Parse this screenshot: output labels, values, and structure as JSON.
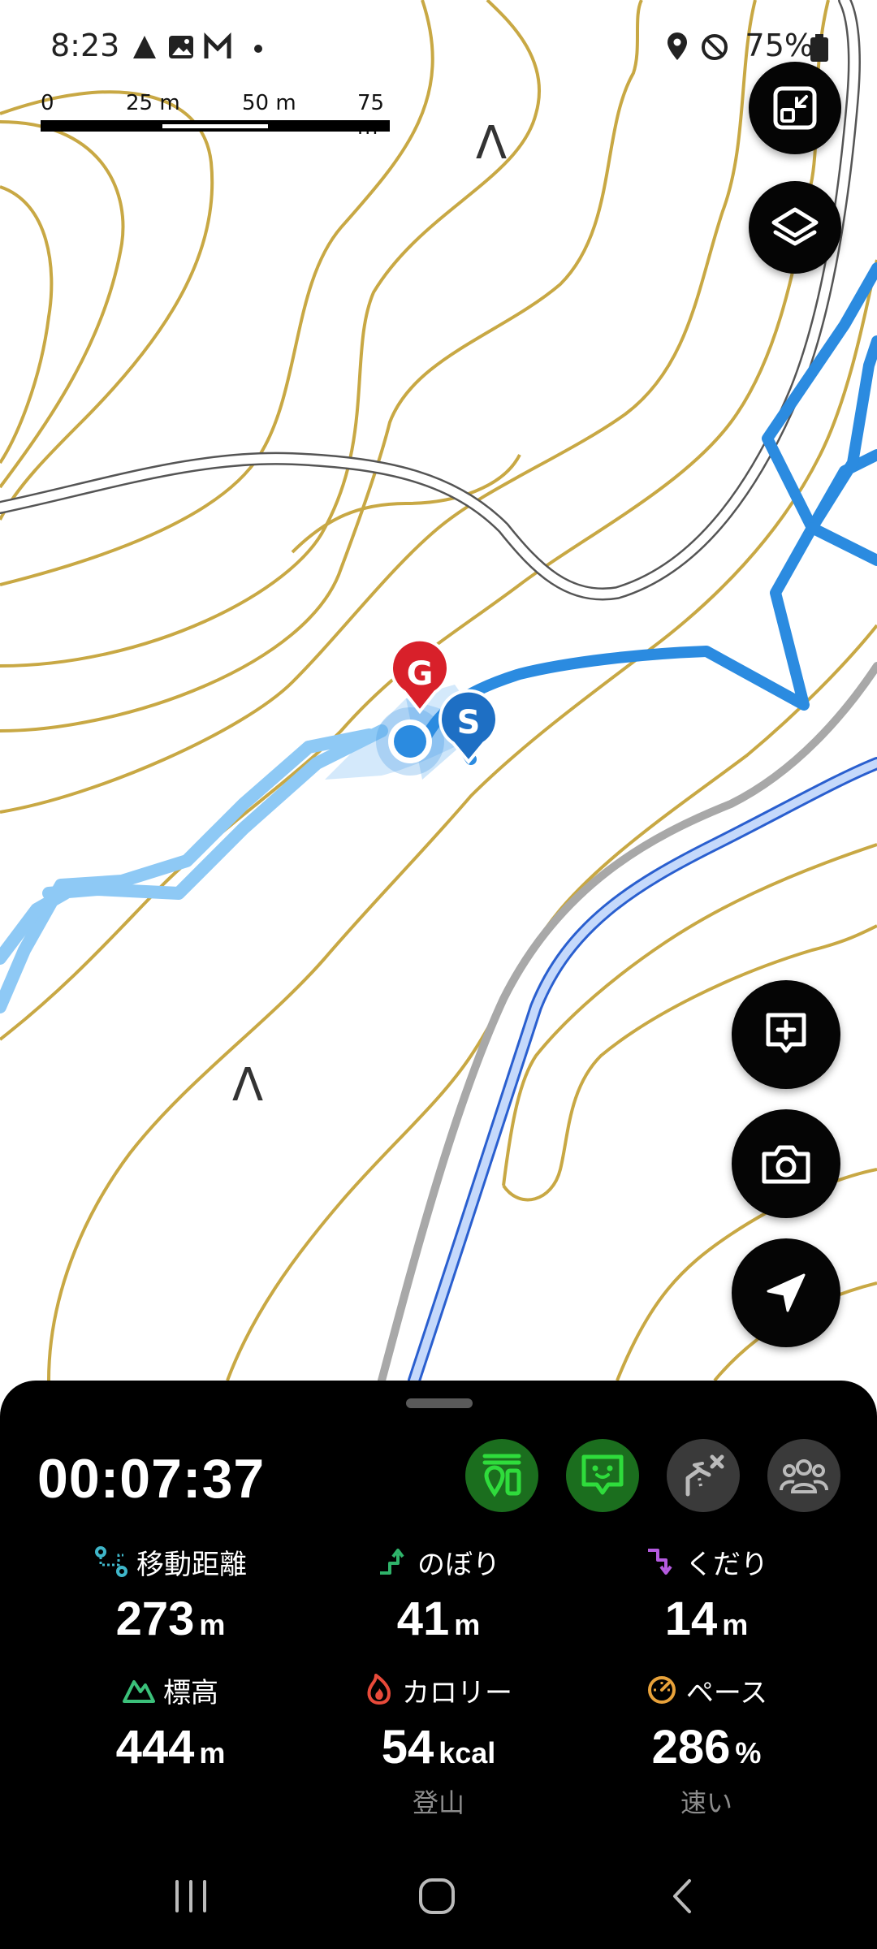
{
  "status_bar": {
    "time": "8:23",
    "battery": "75%"
  },
  "scale_bar": {
    "labels": [
      "0",
      "25 m",
      "50 m",
      "75 m"
    ]
  },
  "map": {
    "markers": {
      "goal": "G",
      "start": "S"
    },
    "summit_symbol": "Λ",
    "buttons": [
      "collapse-map",
      "layers",
      "add-memo",
      "camera",
      "navigation"
    ]
  },
  "tracker": {
    "elapsed": "00:07:37",
    "controls": [
      {
        "name": "trail-status",
        "active": true
      },
      {
        "name": "guide-mascot",
        "active": true
      },
      {
        "name": "route-planning",
        "active": false
      },
      {
        "name": "group",
        "active": false
      }
    ],
    "stats": [
      {
        "label": "移動距離",
        "value": "273",
        "unit": "m",
        "sub": "",
        "icon": "distance-icon",
        "color": "#3fb6c9"
      },
      {
        "label": "のぼり",
        "value": "41",
        "unit": "m",
        "sub": "",
        "icon": "ascent-icon",
        "color": "#2fb36a"
      },
      {
        "label": "くだり",
        "value": "14",
        "unit": "m",
        "sub": "",
        "icon": "descent-icon",
        "color": "#b55be0"
      },
      {
        "label": "標高",
        "value": "444",
        "unit": "m",
        "sub": "",
        "icon": "elevation-icon",
        "color": "#3bc07a"
      },
      {
        "label": "カロリー",
        "value": "54",
        "unit": "kcal",
        "sub": "登山",
        "icon": "calorie-icon",
        "color": "#e84a3a"
      },
      {
        "label": "ペース",
        "value": "286",
        "unit": "%",
        "sub": "速い",
        "icon": "pace-icon",
        "color": "#e8a23a"
      }
    ]
  },
  "colors": {
    "contour": "#c8a844",
    "track_recorded": "#2b8be0",
    "track_planned": "#8ec9f5",
    "road": "#a8a8a8",
    "river": "#2a5fcf",
    "goal_marker": "#d8202a",
    "start_marker": "#1e6fc4",
    "active_control": "#1b6e1e"
  },
  "nav_bar": {
    "buttons": [
      "recent-apps",
      "home",
      "back"
    ]
  }
}
